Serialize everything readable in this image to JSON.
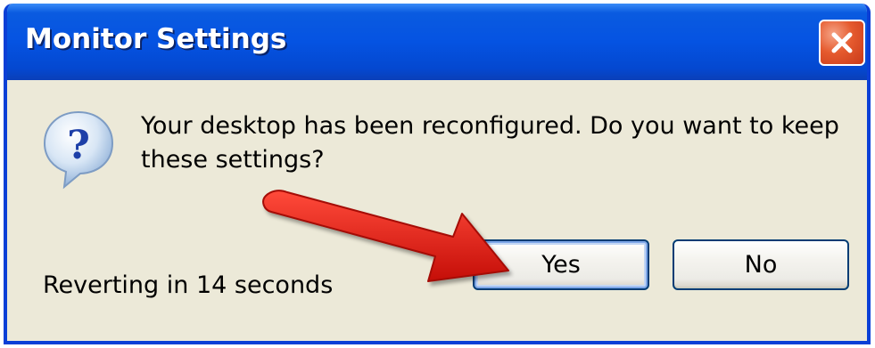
{
  "window": {
    "title": "Monitor Settings",
    "close_icon": "close-icon"
  },
  "dialog": {
    "icon": "question-icon",
    "message_line1": "Your desktop has been reconfigured.  Do you want to keep",
    "message_line2": "these settings?",
    "countdown": "Reverting in 14 seconds",
    "yes_label": "Yes",
    "no_label": "No"
  },
  "annotation": {
    "icon": "red-arrow-icon",
    "color": "#e41b13"
  },
  "colors": {
    "titlebar": "#0553e2",
    "dialog_bg": "#ece9d8",
    "close_button": "#e55a2e",
    "button_border": "#003c74"
  }
}
